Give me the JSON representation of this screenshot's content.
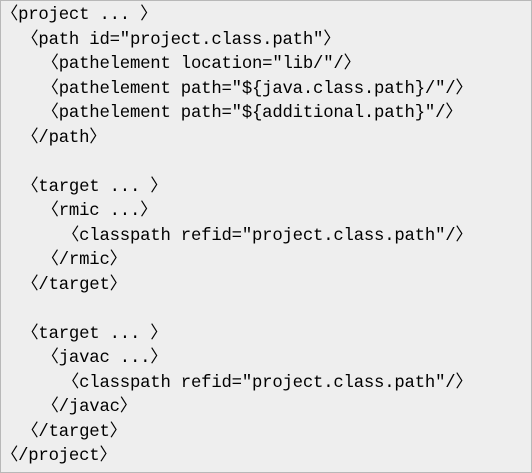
{
  "code": {
    "lines": [
      "〈project ... 〉",
      "  〈path id=\"project.class.path\"〉",
      "    〈pathelement location=\"lib/\"/〉",
      "    〈pathelement path=\"${java.class.path}/\"/〉",
      "    〈pathelement path=\"${additional.path}\"/〉",
      "  〈/path〉",
      "",
      "  〈target ... 〉",
      "    〈rmic ...〉",
      "      〈classpath refid=\"project.class.path\"/〉",
      "    〈/rmic〉",
      "  〈/target〉",
      "",
      "  〈target ... 〉",
      "    〈javac ...〉",
      "      〈classpath refid=\"project.class.path\"/〉",
      "    〈/javac〉",
      "  〈/target〉",
      "〈/project〉"
    ]
  },
  "colors": {
    "background": "#eeeeee",
    "border": "#b8b8b8",
    "text": "#000000"
  }
}
